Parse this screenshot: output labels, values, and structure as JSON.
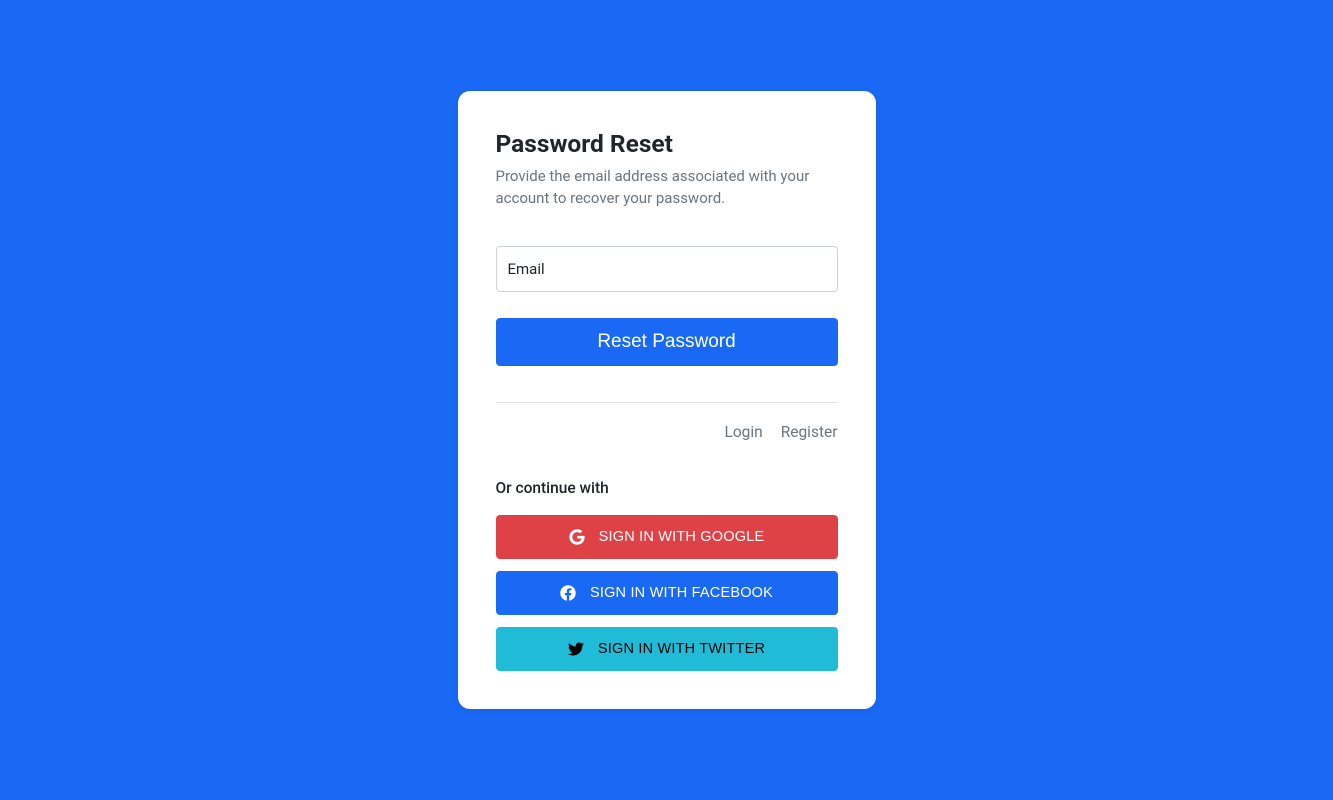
{
  "title": "Password Reset",
  "subtitle": "Provide the email address associated with your account to recover your password.",
  "email": {
    "label": "Email",
    "value": ""
  },
  "reset_button": "Reset Password",
  "links": {
    "login": "Login",
    "register": "Register"
  },
  "continue_label": "Or continue with",
  "social": {
    "google": "SIGN IN WITH GOOGLE",
    "facebook": "SIGN IN WITH FACEBOOK",
    "twitter": "SIGN IN WITH TWITTER"
  }
}
